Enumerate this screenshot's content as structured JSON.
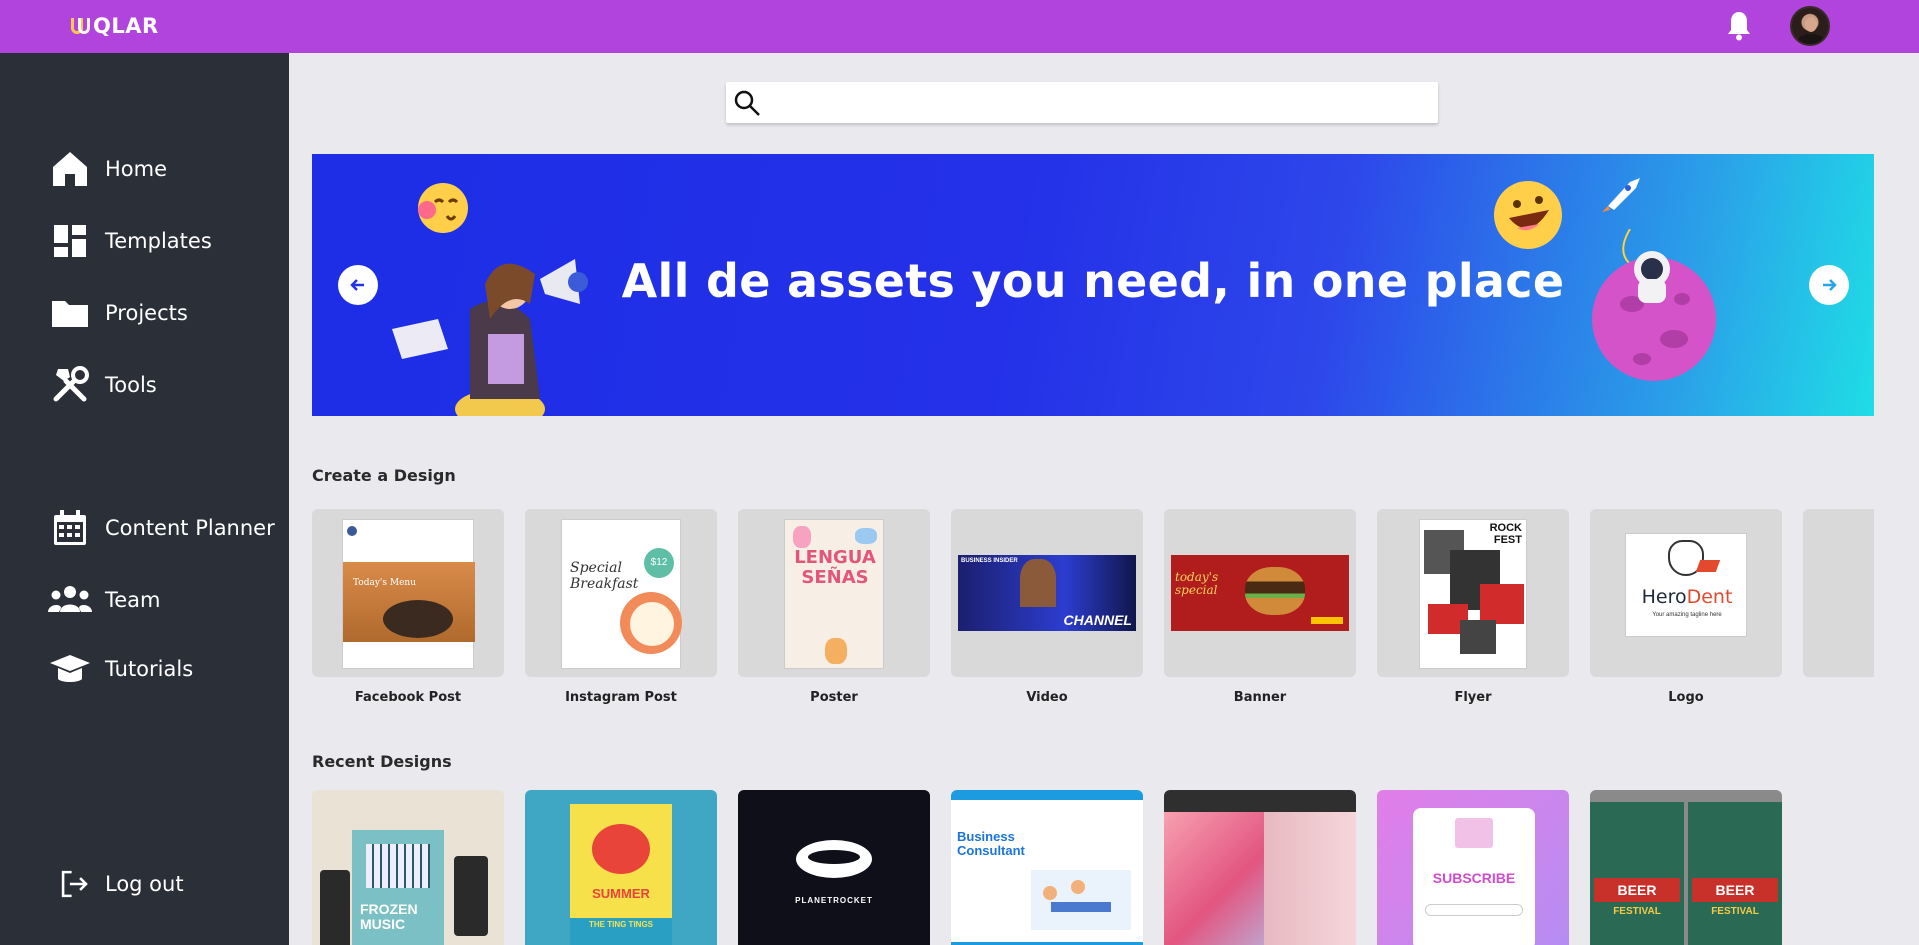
{
  "app": {
    "logo_text": "QLAR"
  },
  "sidebar": {
    "items": [
      {
        "label": "Home",
        "icon": "home-icon"
      },
      {
        "label": "Templates",
        "icon": "templates-icon"
      },
      {
        "label": "Projects",
        "icon": "folder-icon"
      },
      {
        "label": "Tools",
        "icon": "tools-icon"
      },
      {
        "label": "Content Planner",
        "icon": "calendar-icon"
      },
      {
        "label": "Team",
        "icon": "team-icon"
      },
      {
        "label": "Tutorials",
        "icon": "graduation-cap-icon"
      },
      {
        "label": "Log out",
        "icon": "logout-icon"
      }
    ]
  },
  "search": {
    "placeholder": "",
    "value": ""
  },
  "banner": {
    "title": "All de assets you need, in one place"
  },
  "create": {
    "title": "Create a Design",
    "items": [
      {
        "label": "Facebook Post"
      },
      {
        "label": "Instagram Post"
      },
      {
        "label": "Poster"
      },
      {
        "label": "Video"
      },
      {
        "label": "Banner"
      },
      {
        "label": "Flyer"
      },
      {
        "label": "Logo"
      }
    ],
    "thumb_text": {
      "fb_menu": "Today's Menu",
      "ig_title": "Special Breakfast",
      "ig_price": "$12",
      "poster_title": "LENGUA SEÑAS",
      "video_channel": "CHANNEL",
      "video_brand": "BUSINESS INSIDER",
      "banner_text": "today's special",
      "flyer_title": "ROCK FEST",
      "logo_name_a": "Hero",
      "logo_name_b": "Dent",
      "logo_tagline": "Your amazing tagline here"
    }
  },
  "recent": {
    "title": "Recent Designs",
    "thumb_text": {
      "frozen": "FROZEN MUSIC",
      "summer": "SUMMER",
      "summer_sub": "THE TING TINGS",
      "planet": "PLANETROCKET",
      "consultant": "Business Consultant",
      "subscribe": "SUBSCRIBE",
      "beer": "BEER",
      "festival": "FESTIVAL"
    }
  },
  "colors": {
    "topbar": "#b044dc",
    "sidebar": "#2b2f38",
    "banner_start": "#1d2ee6",
    "banner_end": "#1fdde6",
    "content_bg": "#e9e9ee"
  }
}
